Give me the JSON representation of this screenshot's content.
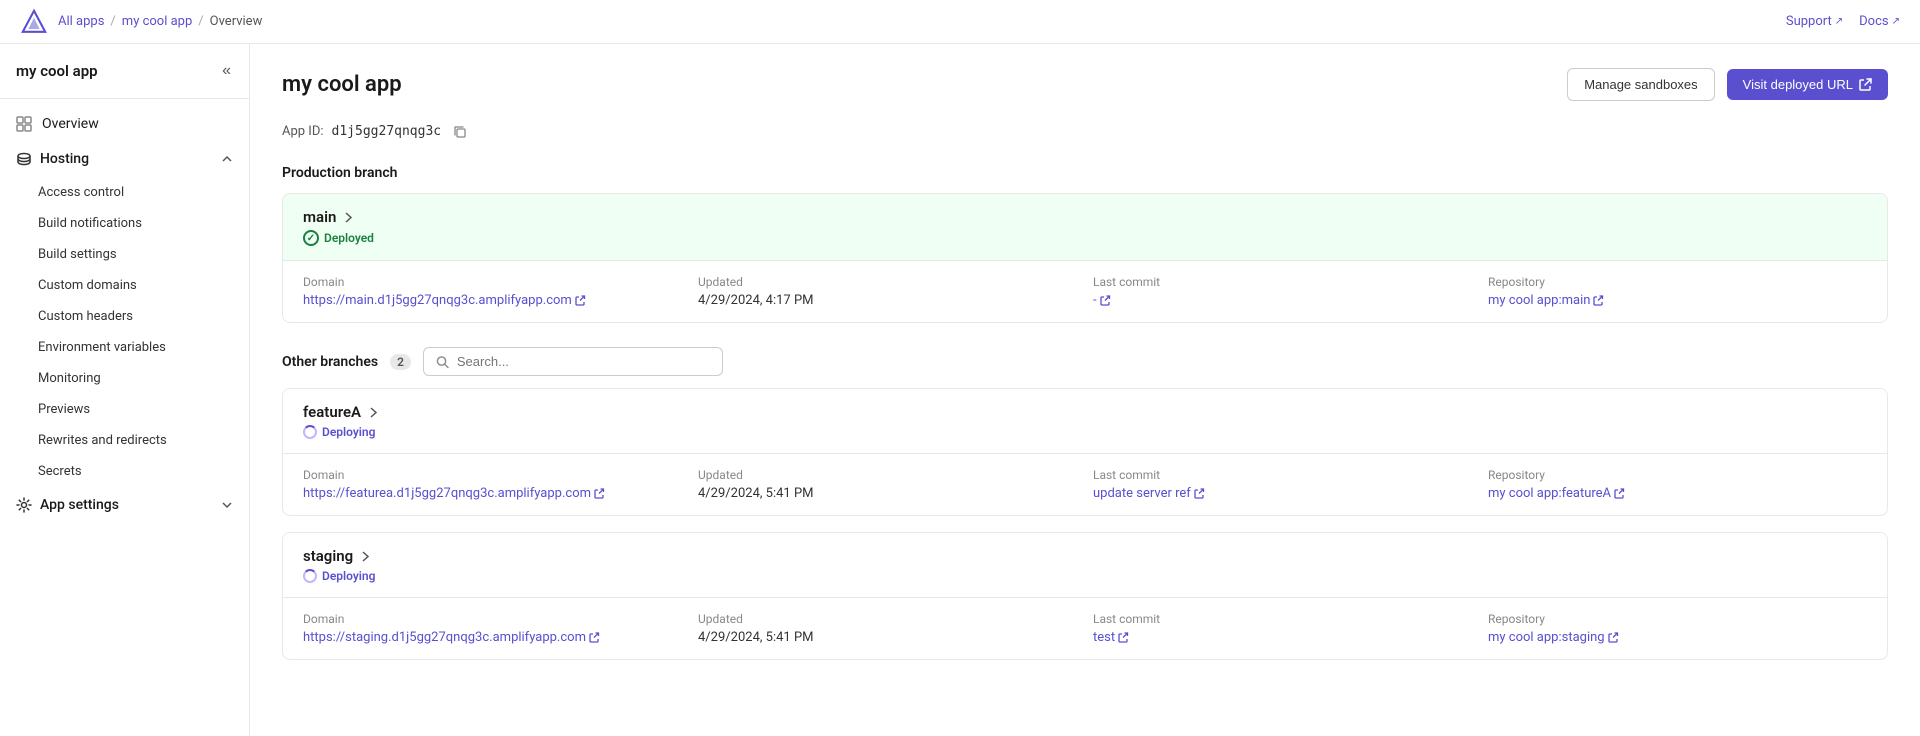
{
  "topNav": {
    "breadcrumbs": [
      "All apps",
      "my cool app",
      "Overview"
    ],
    "supportLabel": "Support",
    "docsLabel": "Docs"
  },
  "sidebar": {
    "appName": "my cool app",
    "overviewLabel": "Overview",
    "hostingLabel": "Hosting",
    "hostingSubItems": [
      "Access control",
      "Build notifications",
      "Build settings",
      "Custom domains",
      "Custom headers",
      "Environment variables",
      "Monitoring",
      "Previews",
      "Rewrites and redirects",
      "Secrets"
    ],
    "appSettingsLabel": "App settings"
  },
  "content": {
    "title": "my cool app",
    "appIdLabel": "App ID:",
    "appIdValue": "d1j5gg27qnqg3c",
    "manageSandboxesLabel": "Manage sandboxes",
    "visitDeployedUrlLabel": "Visit deployed URL",
    "productionBranchLabel": "Production branch",
    "mainBranch": {
      "name": "main",
      "status": "Deployed",
      "domainLabel": "Domain",
      "domainUrl": "https://main.d1j5gg27qnqg3c.amplifyapp.com",
      "updatedLabel": "Updated",
      "updatedValue": "4/29/2024, 4:17 PM",
      "lastCommitLabel": "Last commit",
      "lastCommitValue": "-",
      "repositoryLabel": "Repository",
      "repositoryValue": "my cool app:main"
    },
    "otherBranchesLabel": "Other branches",
    "otherBranchesCount": "2",
    "searchPlaceholder": "Search...",
    "branches": [
      {
        "name": "featureA",
        "status": "Deploying",
        "statusType": "deploying",
        "domainLabel": "Domain",
        "domainUrl": "https://featurea.d1j5gg27qnqg3c.amplifyapp.com",
        "updatedLabel": "Updated",
        "updatedValue": "4/29/2024, 5:41 PM",
        "lastCommitLabel": "Last commit",
        "lastCommitValue": "update server ref",
        "repositoryLabel": "Repository",
        "repositoryValue": "my cool app:featureA"
      },
      {
        "name": "staging",
        "status": "Deploying",
        "statusType": "deploying",
        "domainLabel": "Domain",
        "domainUrl": "https://staging.d1j5gg27qnqg3c.amplifyapp.com",
        "updatedLabel": "Updated",
        "updatedValue": "4/29/2024, 5:41 PM",
        "lastCommitLabel": "Last commit",
        "lastCommitValue": "test",
        "repositoryLabel": "Repository",
        "repositoryValue": "my cool app:staging"
      }
    ]
  }
}
